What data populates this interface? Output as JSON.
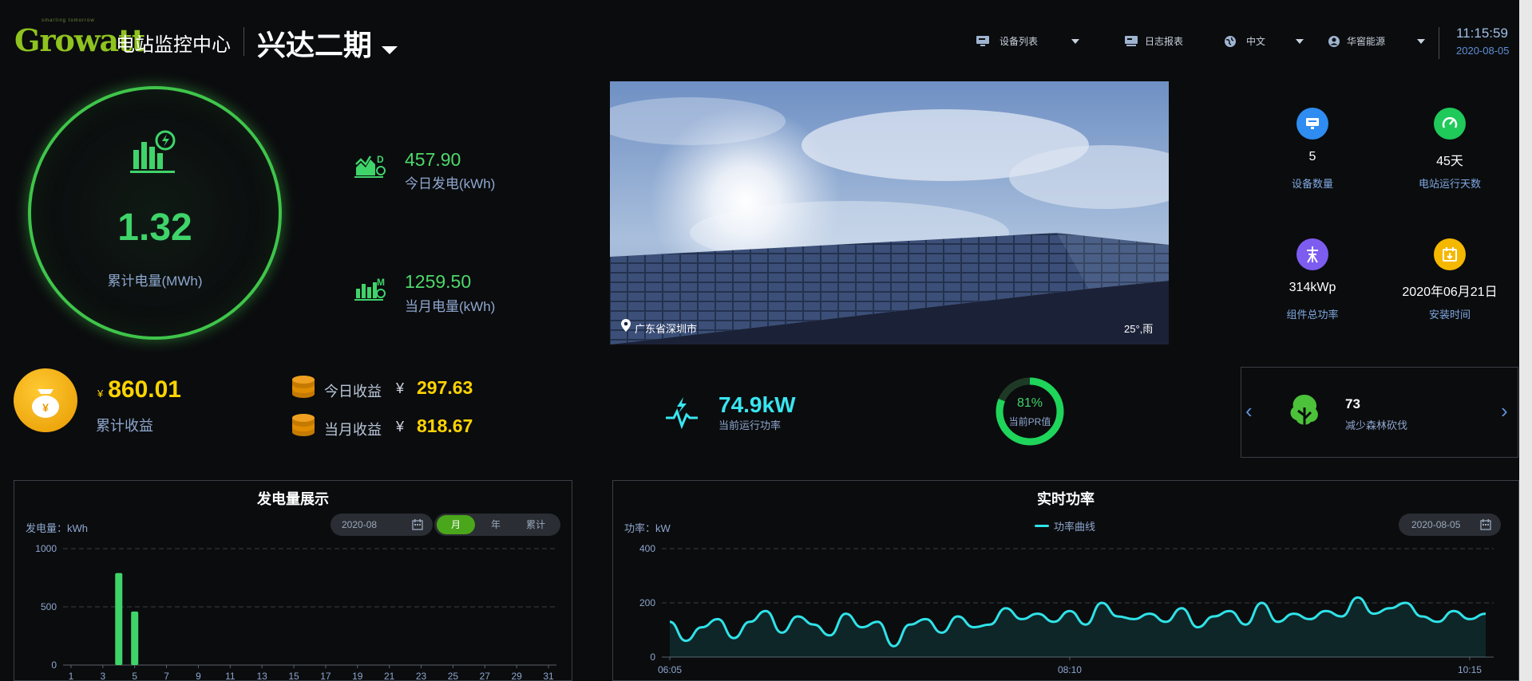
{
  "header": {
    "logo": "Growatt",
    "logo_tagline": "smarting tomorrow",
    "app_title": "电站监控中心",
    "station_name": "兴达二期",
    "nav": {
      "device_list": "设备列表",
      "log_report": "日志报表",
      "language": "中文",
      "user": "华窖能源"
    },
    "time": "11:15:59",
    "date": "2020-08-05"
  },
  "energy": {
    "total_value": "1.32",
    "total_label": "累计电量(MWh)",
    "today_value": "457.90",
    "today_label": "今日发电(kWh)",
    "month_value": "1259.50",
    "month_label": "当月电量(kWh)"
  },
  "photo": {
    "location": "广东省深圳市",
    "weather": "25°,雨"
  },
  "info": [
    {
      "icon": "device-icon",
      "value": "5",
      "label": "设备数量",
      "color": "#2f8cf0"
    },
    {
      "icon": "run-days-icon",
      "value": "45天",
      "label": "电站运行天数",
      "color": "#1fc95a"
    },
    {
      "icon": "power-component-icon",
      "value": "314kWp",
      "label": "组件总功率",
      "color": "#7d5cf0"
    },
    {
      "icon": "calendar-icon",
      "value": "2020年06月21日",
      "label": "安装时间",
      "color": "#f5b800"
    }
  ],
  "income": {
    "currency": "¥",
    "total": "860.01",
    "total_label": "累计收益",
    "today_label": "今日收益",
    "today_value": "297.63",
    "month_label": "当月收益",
    "month_value": "818.67"
  },
  "power": {
    "value": "74.9kW",
    "label": "当前运行功率"
  },
  "pr": {
    "value": "81%",
    "label": "当前PR值",
    "percent": 81
  },
  "forest": {
    "value": "73",
    "label": "减少森林砍伐"
  },
  "chart_data": [
    {
      "type": "bar",
      "title": "发电量展示",
      "ylabel": "发电量：kWh",
      "date": "2020-08",
      "tabs": [
        "月",
        "年",
        "累计"
      ],
      "active_tab": "月",
      "categories": [
        "1",
        "2",
        "3",
        "4",
        "5",
        "6",
        "7",
        "8",
        "9",
        "10",
        "11",
        "12",
        "13",
        "14",
        "15",
        "16",
        "17",
        "18",
        "19",
        "20",
        "21",
        "22",
        "23",
        "24",
        "25",
        "26",
        "27",
        "28",
        "29",
        "30",
        "31"
      ],
      "tick_labels": [
        "1",
        "3",
        "5",
        "7",
        "9",
        "11",
        "13",
        "15",
        "17",
        "19",
        "21",
        "23",
        "25",
        "27",
        "29",
        "31"
      ],
      "values": [
        0,
        0,
        0,
        790,
        460,
        0,
        0,
        0,
        0,
        0,
        0,
        0,
        0,
        0,
        0,
        0,
        0,
        0,
        0,
        0,
        0,
        0,
        0,
        0,
        0,
        0,
        0,
        0,
        0,
        0,
        0
      ],
      "ylim": [
        0,
        1000
      ],
      "yticks": [
        0,
        500,
        1000
      ],
      "grid": true,
      "color": "#3fd46a"
    },
    {
      "type": "area",
      "title": "实时功率",
      "ylabel": "功率：kW",
      "date": "2020-08-05",
      "legend": "功率曲线",
      "x_start_min": 365,
      "x_step_min": 5,
      "xticks": [
        {
          "min": 365,
          "label": "06:05"
        },
        {
          "min": 490,
          "label": "08:10"
        },
        {
          "min": 615,
          "label": "10:15"
        }
      ],
      "values": [
        130,
        60,
        110,
        140,
        70,
        130,
        170,
        90,
        150,
        120,
        80,
        160,
        110,
        130,
        40,
        120,
        140,
        90,
        150,
        110,
        120,
        180,
        140,
        160,
        130,
        170,
        120,
        200,
        150,
        140,
        160,
        130,
        180,
        110,
        150,
        170,
        120,
        200,
        130,
        160,
        140,
        170,
        150,
        220,
        160,
        180,
        200,
        150,
        130,
        170,
        140,
        160
      ],
      "ylim": [
        0,
        400
      ],
      "yticks": [
        0,
        200,
        400
      ],
      "grid": true,
      "color": "#2fe3e8"
    }
  ]
}
